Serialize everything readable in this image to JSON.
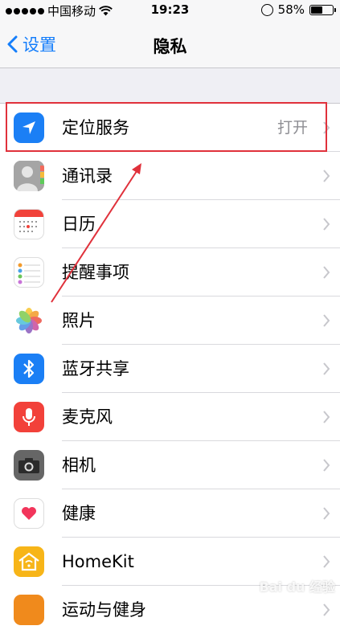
{
  "status_bar": {
    "carrier": "中国移动",
    "time": "19:23",
    "battery_text": "58%",
    "battery_level": 0.58
  },
  "nav": {
    "back_label": "设置",
    "title": "隐私"
  },
  "rows": [
    {
      "label": "定位服务",
      "value": "打开",
      "icon": "location-arrow-icon",
      "color": "#1b7ff5"
    },
    {
      "label": "通讯录",
      "icon": "contacts-icon",
      "color": "#9c9c9c"
    },
    {
      "label": "日历",
      "icon": "calendar-icon",
      "color": "#ffffff"
    },
    {
      "label": "提醒事项",
      "icon": "reminders-icon",
      "color": "#ffffff"
    },
    {
      "label": "照片",
      "icon": "photos-icon",
      "color": "#ffffff"
    },
    {
      "label": "蓝牙共享",
      "icon": "bluetooth-icon",
      "color": "#1b7ff5"
    },
    {
      "label": "麦克风",
      "icon": "microphone-icon",
      "color": "#f2413a"
    },
    {
      "label": "相机",
      "icon": "camera-icon",
      "color": "#666666"
    },
    {
      "label": "健康",
      "icon": "health-heart-icon",
      "color": "#ffffff"
    },
    {
      "label": "HomeKit",
      "icon": "homekit-icon",
      "color": "#f7b518"
    },
    {
      "label": "运动与健身",
      "icon": "motion-icon",
      "color": "#f08a1c"
    }
  ],
  "watermark": "Bai du 经验"
}
